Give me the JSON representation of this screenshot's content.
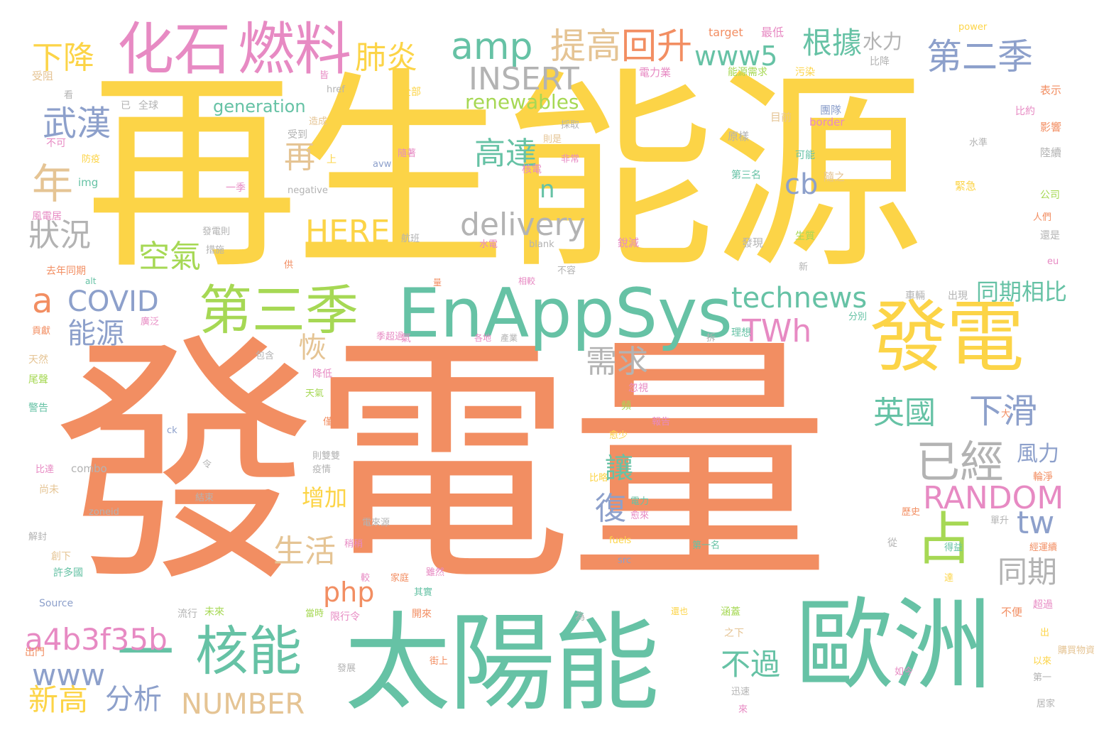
{
  "palette": {
    "orange": "#f28e62",
    "yellow": "#fcd447",
    "green": "#66c2a5",
    "pink": "#e78ac3",
    "lime": "#a6d854",
    "blue": "#8da0cb",
    "tan": "#e5c494",
    "gray": "#b3b3b3"
  },
  "words": [
    {
      "text": "發電量",
      "color": "orange"
    },
    {
      "text": "再生能源",
      "color": "yellow"
    },
    {
      "text": "太陽能",
      "color": "green"
    },
    {
      "text": "歐洲",
      "color": "green"
    },
    {
      "text": "發電",
      "color": "yellow"
    },
    {
      "text": "EnAppSys",
      "color": "green"
    },
    {
      "text": "化石",
      "color": "pink"
    },
    {
      "text": "燃料",
      "color": "pink"
    },
    {
      "text": "第三季",
      "color": "lime"
    },
    {
      "text": "核能",
      "color": "green"
    },
    {
      "text": "占",
      "color": "lime"
    },
    {
      "text": "一",
      "color": "green"
    },
    {
      "text": "年",
      "color": "tan"
    },
    {
      "text": "amp",
      "color": "green"
    },
    {
      "text": "提高",
      "color": "tan"
    },
    {
      "text": "回升",
      "color": "orange"
    },
    {
      "text": "第二季",
      "color": "blue"
    },
    {
      "text": "根據",
      "color": "green"
    },
    {
      "text": "水力",
      "color": "gray"
    },
    {
      "text": "www5",
      "color": "green"
    },
    {
      "text": "肺炎",
      "color": "yellow"
    },
    {
      "text": "下降",
      "color": "yellow"
    },
    {
      "text": "INSERT",
      "color": "gray"
    },
    {
      "text": "renewables",
      "color": "lime"
    },
    {
      "text": "generation",
      "color": "green"
    },
    {
      "text": "武漢",
      "color": "blue"
    },
    {
      "text": "高達",
      "color": "green"
    },
    {
      "text": "再",
      "color": "tan"
    },
    {
      "text": "n",
      "color": "green"
    },
    {
      "text": "cb",
      "color": "blue"
    },
    {
      "text": "delivery",
      "color": "gray"
    },
    {
      "text": "HERE",
      "color": "yellow"
    },
    {
      "text": "狀況",
      "color": "gray"
    },
    {
      "text": "空氣",
      "color": "lime"
    },
    {
      "text": "a",
      "color": "orange"
    },
    {
      "text": "COVID",
      "color": "blue"
    },
    {
      "text": "technews",
      "color": "green"
    },
    {
      "text": "同期相比",
      "color": "green"
    },
    {
      "text": "TWh",
      "color": "pink"
    },
    {
      "text": "能源",
      "color": "blue"
    },
    {
      "text": "恢",
      "color": "tan"
    },
    {
      "text": "需求",
      "color": "gray"
    },
    {
      "text": "英國",
      "color": "green"
    },
    {
      "text": "下滑",
      "color": "blue"
    },
    {
      "text": "已經",
      "color": "gray"
    },
    {
      "text": "風力",
      "color": "blue"
    },
    {
      "text": "讓",
      "color": "green"
    },
    {
      "text": "復",
      "color": "blue"
    },
    {
      "text": "增加",
      "color": "yellow"
    },
    {
      "text": "RANDOM",
      "color": "pink"
    },
    {
      "text": "tw",
      "color": "blue"
    },
    {
      "text": "生活",
      "color": "tan"
    },
    {
      "text": "同期",
      "color": "gray"
    },
    {
      "text": "php",
      "color": "orange"
    },
    {
      "text": "a4b3f35b",
      "color": "pink"
    },
    {
      "text": "www",
      "color": "blue"
    },
    {
      "text": "不過",
      "color": "green"
    },
    {
      "text": "新高",
      "color": "yellow"
    },
    {
      "text": "分析",
      "color": "blue"
    },
    {
      "text": "NUMBER",
      "color": "tan"
    },
    {
      "text": "target",
      "color": "orange"
    },
    {
      "text": "最低",
      "color": "pink"
    },
    {
      "text": "power",
      "color": "yellow"
    },
    {
      "text": "電力業",
      "color": "pink"
    },
    {
      "text": "能源需求",
      "color": "lime"
    },
    {
      "text": "污染",
      "color": "yellow"
    },
    {
      "text": "比降",
      "color": "gray"
    },
    {
      "text": "表示",
      "color": "orange"
    },
    {
      "text": "團隊",
      "color": "blue"
    },
    {
      "text": "目前",
      "color": "tan"
    },
    {
      "text": "border",
      "color": "pink"
    },
    {
      "text": "比約",
      "color": "pink"
    },
    {
      "text": "影響",
      "color": "orange"
    },
    {
      "text": "原樣",
      "color": "gray"
    },
    {
      "text": "水準",
      "color": "gray"
    },
    {
      "text": "陸續",
      "color": "gray"
    },
    {
      "text": "可能",
      "color": "green"
    },
    {
      "text": "緊急",
      "color": "yellow"
    },
    {
      "text": "第三名",
      "color": "green"
    },
    {
      "text": "隨之",
      "color": "tan"
    },
    {
      "text": "公司",
      "color": "lime"
    },
    {
      "text": "人們",
      "color": "orange"
    },
    {
      "text": "生質",
      "color": "lime"
    },
    {
      "text": "還是",
      "color": "gray"
    },
    {
      "text": "發現",
      "color": "gray"
    },
    {
      "text": "新",
      "color": "gray"
    },
    {
      "text": "eu",
      "color": "pink"
    },
    {
      "text": "車輛",
      "color": "gray"
    },
    {
      "text": "出現",
      "color": "gray"
    },
    {
      "text": "分別",
      "color": "green"
    },
    {
      "text": "理想",
      "color": "green"
    },
    {
      "text": "拆",
      "color": "gray"
    },
    {
      "text": "受阻",
      "color": "tan"
    },
    {
      "text": "看",
      "color": "gray"
    },
    {
      "text": "已",
      "color": "gray"
    },
    {
      "text": "全球",
      "color": "gray"
    },
    {
      "text": "不可",
      "color": "pink"
    },
    {
      "text": "受到",
      "color": "gray"
    },
    {
      "text": "防疫",
      "color": "yellow"
    },
    {
      "text": "img",
      "color": "green"
    },
    {
      "text": "風電居",
      "color": "pink"
    },
    {
      "text": "去年同期",
      "color": "orange"
    },
    {
      "text": "貢獻",
      "color": "orange"
    },
    {
      "text": "天然",
      "color": "tan"
    },
    {
      "text": "尾聲",
      "color": "lime"
    },
    {
      "text": "警告",
      "color": "green"
    },
    {
      "text": "比達",
      "color": "pink"
    },
    {
      "text": "尚未",
      "color": "tan"
    },
    {
      "text": "解封",
      "color": "gray"
    },
    {
      "text": "許多國",
      "color": "green"
    },
    {
      "text": "創下",
      "color": "tan"
    },
    {
      "text": "Source",
      "color": "blue"
    },
    {
      "text": "出門",
      "color": "orange"
    },
    {
      "text": "zoneid",
      "color": "gray"
    },
    {
      "text": "combo",
      "color": "gray"
    },
    {
      "text": "alt",
      "color": "green"
    },
    {
      "text": "流行",
      "color": "gray"
    },
    {
      "text": "未來",
      "color": "lime"
    },
    {
      "text": "皆",
      "color": "pink"
    },
    {
      "text": "href",
      "color": "gray"
    },
    {
      "text": "造成",
      "color": "tan"
    },
    {
      "text": "全部",
      "color": "yellow"
    },
    {
      "text": "採取",
      "color": "gray"
    },
    {
      "text": "則是",
      "color": "tan"
    },
    {
      "text": "非常",
      "color": "pink"
    },
    {
      "text": "隨著",
      "color": "pink"
    },
    {
      "text": "avw",
      "color": "blue"
    },
    {
      "text": "核電",
      "color": "pink"
    },
    {
      "text": "一季",
      "color": "pink"
    },
    {
      "text": "negative",
      "color": "gray"
    },
    {
      "text": "發電則",
      "color": "gray"
    },
    {
      "text": "措施",
      "color": "gray"
    },
    {
      "text": "航班",
      "color": "gray"
    },
    {
      "text": "水電",
      "color": "pink"
    },
    {
      "text": "blank",
      "color": "gray"
    },
    {
      "text": "銳減",
      "color": "pink"
    },
    {
      "text": "供",
      "color": "orange"
    },
    {
      "text": "不容",
      "color": "gray"
    },
    {
      "text": "相較",
      "color": "pink"
    },
    {
      "text": "廣泛",
      "color": "pink"
    },
    {
      "text": "季超過",
      "color": "pink"
    },
    {
      "text": "氣",
      "color": "pink"
    },
    {
      "text": "各地",
      "color": "pink"
    },
    {
      "text": "產業",
      "color": "gray"
    },
    {
      "text": "包含",
      "color": "gray"
    },
    {
      "text": "降低",
      "color": "pink"
    },
    {
      "text": "天氣",
      "color": "lime"
    },
    {
      "text": "忽視",
      "color": "pink"
    },
    {
      "text": "頻",
      "color": "lime"
    },
    {
      "text": "報告",
      "color": "pink"
    },
    {
      "text": "大",
      "color": "orange"
    },
    {
      "text": "僅",
      "color": "orange"
    },
    {
      "text": "愈少",
      "color": "yellow"
    },
    {
      "text": "ck",
      "color": "blue"
    },
    {
      "text": "則雙雙",
      "color": "gray"
    },
    {
      "text": "疫情",
      "color": "gray"
    },
    {
      "text": "結束",
      "color": "gray"
    },
    {
      "text": "令",
      "color": "gray"
    },
    {
      "text": "比略",
      "color": "yellow"
    },
    {
      "text": "電力",
      "color": "green"
    },
    {
      "text": "愈來",
      "color": "pink"
    },
    {
      "text": "輪淨",
      "color": "orange"
    },
    {
      "text": "歷史",
      "color": "orange"
    },
    {
      "text": "單升",
      "color": "gray"
    },
    {
      "text": "電來源",
      "color": "gray"
    },
    {
      "text": "fuels",
      "color": "yellow"
    },
    {
      "text": "第一名",
      "color": "green"
    },
    {
      "text": "得益",
      "color": "green"
    },
    {
      "text": "經運續",
      "color": "orange"
    },
    {
      "text": "從",
      "color": "gray"
    },
    {
      "text": "稍稍",
      "color": "pink"
    },
    {
      "text": "src",
      "color": "blue"
    },
    {
      "text": "雖然",
      "color": "pink"
    },
    {
      "text": "較",
      "color": "pink"
    },
    {
      "text": "家庭",
      "color": "orange"
    },
    {
      "text": "其實",
      "color": "green"
    },
    {
      "text": "達",
      "color": "yellow"
    },
    {
      "text": "當時",
      "color": "lime"
    },
    {
      "text": "限行令",
      "color": "pink"
    },
    {
      "text": "開來",
      "color": "orange"
    },
    {
      "text": "為",
      "color": "gray"
    },
    {
      "text": "還也",
      "color": "yellow"
    },
    {
      "text": "涵蓋",
      "color": "lime"
    },
    {
      "text": "不便",
      "color": "orange"
    },
    {
      "text": "超過",
      "color": "pink"
    },
    {
      "text": "出",
      "color": "yellow"
    },
    {
      "text": "購買物資",
      "color": "tan"
    },
    {
      "text": "之下",
      "color": "tan"
    },
    {
      "text": "以來",
      "color": "yellow"
    },
    {
      "text": "第一",
      "color": "gray"
    },
    {
      "text": "居家",
      "color": "gray"
    },
    {
      "text": "發展",
      "color": "gray"
    },
    {
      "text": "街上",
      "color": "orange"
    },
    {
      "text": "如今",
      "color": "pink"
    },
    {
      "text": "迅速",
      "color": "gray"
    },
    {
      "text": "來",
      "color": "pink"
    },
    {
      "text": "上",
      "color": "yellow"
    },
    {
      "text": "量",
      "color": "orange"
    }
  ]
}
